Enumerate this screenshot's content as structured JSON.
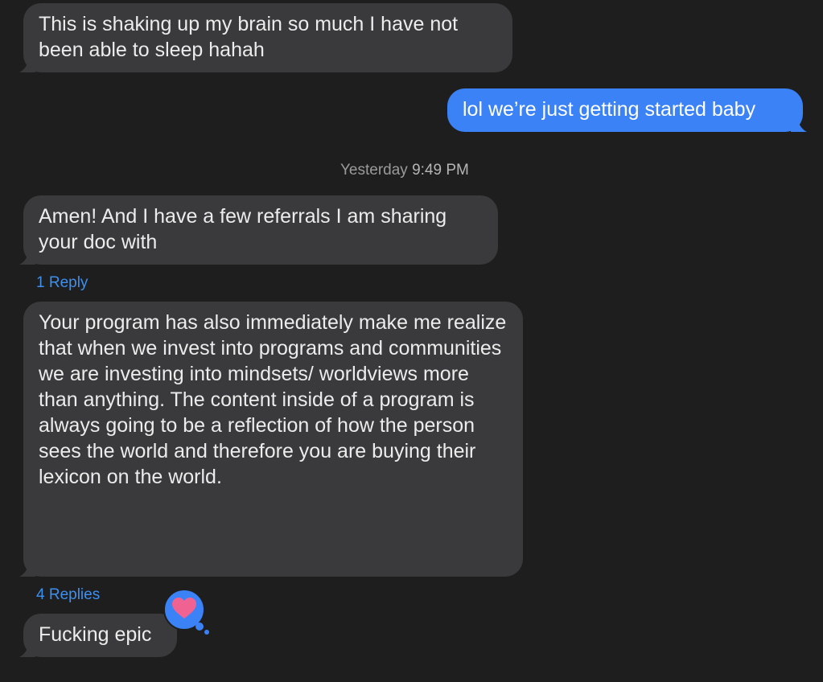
{
  "messages": {
    "m1": "This is shaking up my brain so much I have not been able to sleep hahah",
    "m2": "lol we’re just getting started baby",
    "m3": "Amen! And I have a few referrals I am sharing your doc with",
    "m4": "Your program has also immediately make me realize that when we invest into programs and communities we are investing into mindsets/ worldviews more than anything. The content inside of a program is always going to be a reflection of how the person sees the world and therefore you are buying their lexicon on the world.",
    "m5": "Fucking epic"
  },
  "timestamp": {
    "day": "Yesterday",
    "time": "9:49 PM"
  },
  "replies": {
    "r1": "1 Reply",
    "r2": "4 Replies"
  },
  "tapback": {
    "icon": "heart-icon",
    "bubble_color": "#3b82f6",
    "heart_color": "#f06292"
  },
  "colors": {
    "background": "#1e1e1e",
    "incoming_bubble": "#3a3a3c",
    "outgoing_bubble": "#3b82f6",
    "link": "#3d8ff0"
  }
}
